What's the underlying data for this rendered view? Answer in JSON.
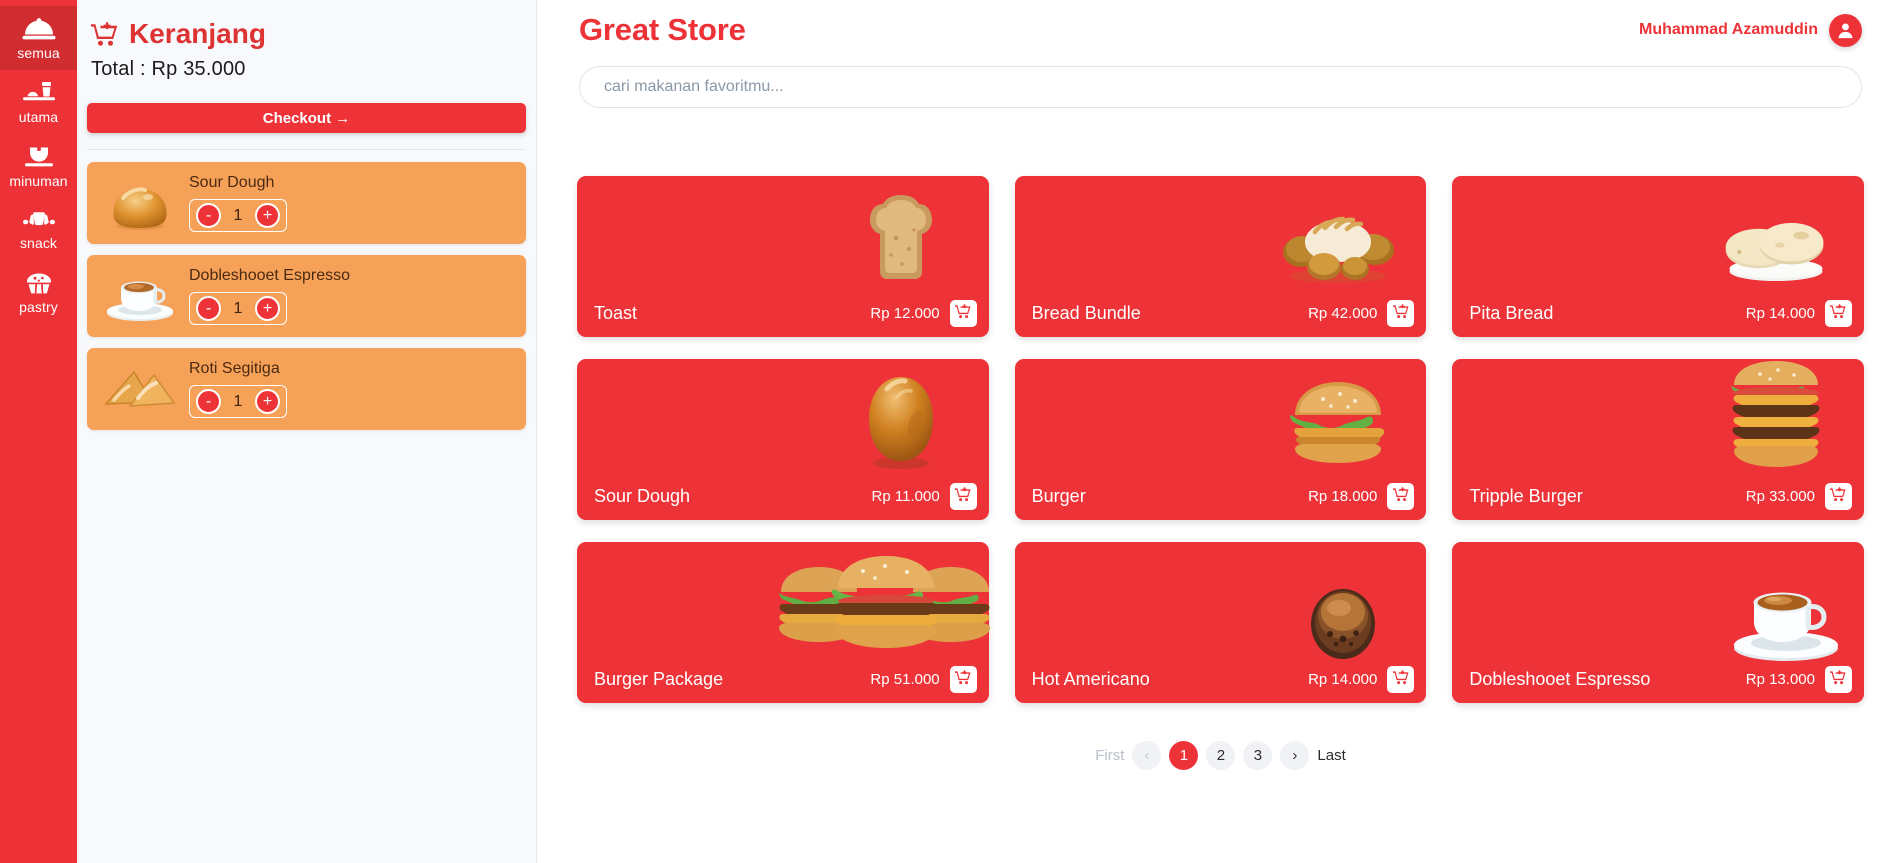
{
  "sidebar": {
    "items": [
      {
        "label": "semua",
        "icon": "cloche-icon",
        "active": true
      },
      {
        "label": "utama",
        "icon": "meal-tray-icon",
        "active": false
      },
      {
        "label": "minuman",
        "icon": "coffee-cup-icon",
        "active": false
      },
      {
        "label": "snack",
        "icon": "croissant-icon",
        "active": false
      },
      {
        "label": "pastry",
        "icon": "cupcake-icon",
        "active": false
      }
    ]
  },
  "cart": {
    "title": "Keranjang",
    "title_icon": "cart-plus-icon",
    "total_label": "Total : Rp 35.000",
    "checkout_label": "Checkout  →",
    "items": [
      {
        "name": "Sour Dough",
        "qty": "1",
        "image": "bread-roll-image",
        "minus": "-",
        "plus": "+"
      },
      {
        "name": "Dobleshooet Espresso",
        "qty": "1",
        "image": "espresso-cup-image",
        "minus": "-",
        "plus": "+"
      },
      {
        "name": "Roti Segitiga",
        "qty": "1",
        "image": "pastry-triangle-image",
        "minus": "-",
        "plus": "+"
      }
    ]
  },
  "header": {
    "brand": "Great Store",
    "user_name": "Muhammad Azamuddin",
    "avatar_icon": "user-circle-icon"
  },
  "search": {
    "placeholder": "cari makanan favoritmu...",
    "value": ""
  },
  "products": [
    {
      "name": "Toast",
      "price": "Rp 12.000",
      "image": "toast-slice-image",
      "add_icon": "cart-plus-icon"
    },
    {
      "name": "Bread Bundle",
      "price": "Rp 42.000",
      "image": "bread-bundle-image",
      "add_icon": "cart-plus-icon"
    },
    {
      "name": "Pita Bread",
      "price": "Rp 14.000",
      "image": "pita-bread-image",
      "add_icon": "cart-plus-icon"
    },
    {
      "name": "Sour Dough",
      "price": "Rp 11.000",
      "image": "sourdough-image",
      "add_icon": "cart-plus-icon"
    },
    {
      "name": "Burger",
      "price": "Rp 18.000",
      "image": "burger-image",
      "add_icon": "cart-plus-icon"
    },
    {
      "name": "Tripple Burger",
      "price": "Rp 33.000",
      "image": "triple-burger-image",
      "add_icon": "cart-plus-icon"
    },
    {
      "name": "Burger Package",
      "price": "Rp 51.000",
      "image": "burger-package-image",
      "add_icon": "cart-plus-icon"
    },
    {
      "name": "Hot Americano",
      "price": "Rp 14.000",
      "image": "americano-cup-image",
      "add_icon": "cart-plus-icon"
    },
    {
      "name": "Dobleshooet Espresso",
      "price": "Rp 13.000",
      "image": "espresso-cup-image",
      "add_icon": "cart-plus-icon"
    }
  ],
  "pagination": {
    "first_label": "First",
    "prev_label": "‹",
    "pages": [
      {
        "label": "1",
        "active": true
      },
      {
        "label": "2",
        "active": false
      },
      {
        "label": "3",
        "active": false
      }
    ],
    "next_label": "›",
    "last_label": "Last"
  },
  "colors": {
    "brand_red": "#EE3338",
    "sidebar_red": "#ED3237",
    "sidebar_active": "#D12C30",
    "cart_item_orange": "#F6A158",
    "panel_bg": "#F7F9FC"
  }
}
